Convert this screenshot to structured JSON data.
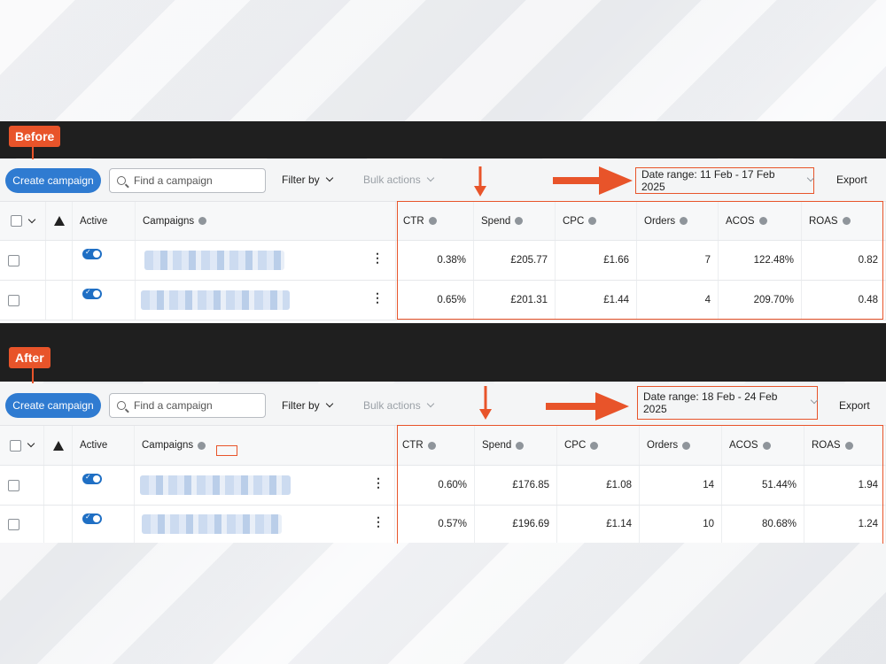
{
  "before": {
    "tag": "Before",
    "toolbar": {
      "create_label": "Create campaign",
      "search_placeholder": "Find a campaign",
      "filter_label": "Filter by",
      "bulk_label": "Bulk actions",
      "date_range_label": "Date range: 11 Feb - 17 Feb 2025",
      "export_label": "Export"
    },
    "columns": [
      "Active",
      "Campaigns",
      "CTR",
      "Spend",
      "CPC",
      "Orders",
      "ACOS",
      "ROAS"
    ],
    "rows": [
      {
        "ctr": "0.38%",
        "spend": "£205.77",
        "cpc": "£1.66",
        "orders": "7",
        "acos": "122.48%",
        "roas": "0.82"
      },
      {
        "ctr": "0.65%",
        "spend": "£201.31",
        "cpc": "£1.44",
        "orders": "4",
        "acos": "209.70%",
        "roas": "0.48"
      }
    ]
  },
  "after": {
    "tag": "After",
    "toolbar": {
      "create_label": "Create campaign",
      "search_placeholder": "Find a campaign",
      "filter_label": "Filter by",
      "bulk_label": "Bulk actions",
      "date_range_label": "Date range: 18 Feb - 24 Feb 2025",
      "export_label": "Export"
    },
    "columns": [
      "Active",
      "Campaigns",
      "CTR",
      "Spend",
      "CPC",
      "Orders",
      "ACOS",
      "ROAS"
    ],
    "rows": [
      {
        "ctr": "0.60%",
        "spend": "£176.85",
        "cpc": "£1.08",
        "orders": "14",
        "acos": "51.44%",
        "roas": "1.94"
      },
      {
        "ctr": "0.57%",
        "spend": "£196.69",
        "cpc": "£1.14",
        "orders": "10",
        "acos": "80.68%",
        "roas": "1.24"
      }
    ]
  },
  "colors": {
    "accent": "#e8542a",
    "primary": "#2f7bd1"
  }
}
